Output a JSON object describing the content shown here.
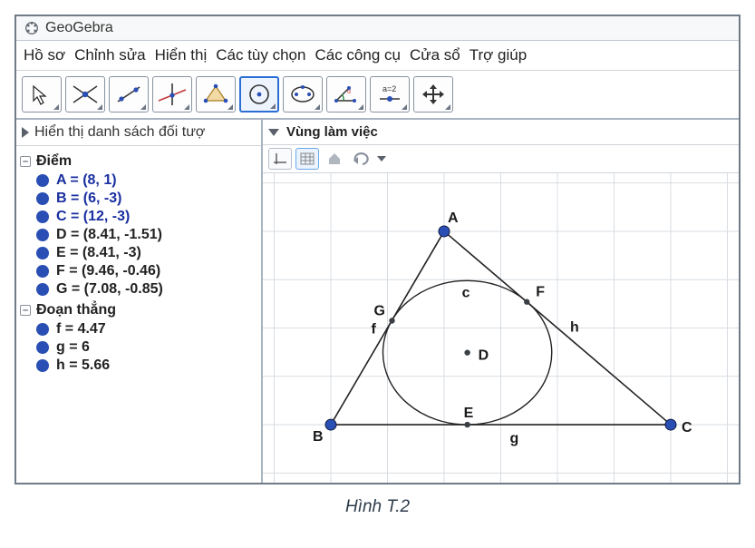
{
  "app": {
    "title": "GeoGebra"
  },
  "menu": {
    "items": [
      "Hồ sơ",
      "Chỉnh sửa",
      "Hiển thị",
      "Các tùy chọn",
      "Các công cụ",
      "Cửa sổ",
      "Trợ giúp"
    ]
  },
  "toolbar": {
    "tools": [
      {
        "name": "move-tool",
        "active": false
      },
      {
        "name": "point-tool",
        "active": false
      },
      {
        "name": "line-tool",
        "active": false
      },
      {
        "name": "perpendicular-tool",
        "active": false
      },
      {
        "name": "polygon-tool",
        "active": false
      },
      {
        "name": "circle-center-tool",
        "active": true
      },
      {
        "name": "ellipse-tool",
        "active": false
      },
      {
        "name": "angle-tool",
        "active": false
      },
      {
        "name": "slider-tool",
        "active": false,
        "label": "a=2"
      },
      {
        "name": "move-view-tool",
        "active": false
      }
    ]
  },
  "sidebar": {
    "title": "Hiển thị danh sách đối tượ",
    "groups": [
      {
        "label": "Điểm",
        "items": [
          {
            "text": "A = (8, 1)",
            "bluebold": true
          },
          {
            "text": "B = (6, -3)",
            "bluebold": true
          },
          {
            "text": "C = (12, -3)",
            "bluebold": true
          },
          {
            "text": "D = (8.41, -1.51)",
            "bluebold": false
          },
          {
            "text": "E = (8.41, -3)",
            "bluebold": false
          },
          {
            "text": "F = (9.46, -0.46)",
            "bluebold": false
          },
          {
            "text": "G = (7.08, -0.85)",
            "bluebold": false
          }
        ]
      },
      {
        "label": "Đoạn thẳng",
        "items": [
          {
            "text": "f = 4.47",
            "bluebold": false
          },
          {
            "text": "g = 6",
            "bluebold": false
          },
          {
            "text": "h = 5.66",
            "bluebold": false
          }
        ]
      }
    ]
  },
  "canvas": {
    "title": "Vùng làm việc",
    "mini_tools": [
      {
        "name": "axes-toggle"
      },
      {
        "name": "grid-toggle",
        "active": true
      },
      {
        "name": "home-icon"
      },
      {
        "name": "undo-icon"
      }
    ]
  },
  "geometry": {
    "points": {
      "A": {
        "x": 8,
        "y": 1,
        "label": "A",
        "style": "big"
      },
      "B": {
        "x": 6,
        "y": -3,
        "label": "B",
        "style": "big"
      },
      "C": {
        "x": 12,
        "y": -3,
        "label": "C",
        "style": "big"
      },
      "D": {
        "x": 8.41,
        "y": -1.51,
        "label": "D",
        "style": "small"
      },
      "E": {
        "x": 8.41,
        "y": -3,
        "label": "E",
        "style": "small"
      },
      "F": {
        "x": 9.46,
        "y": -0.46,
        "label": "F",
        "style": "small"
      },
      "G": {
        "x": 7.08,
        "y": -0.85,
        "label": "G",
        "style": "small"
      }
    },
    "segments": {
      "f": {
        "from": "A",
        "to": "B",
        "label": "f",
        "value": 4.47
      },
      "g": {
        "from": "B",
        "to": "C",
        "label": "g",
        "value": 6
      },
      "h": {
        "from": "C",
        "to": "A",
        "label": "h",
        "value": 5.66
      }
    },
    "circle": {
      "name": "c",
      "center": "D",
      "radius": 1.49,
      "label": "c"
    }
  },
  "caption": "Hình T.2"
}
